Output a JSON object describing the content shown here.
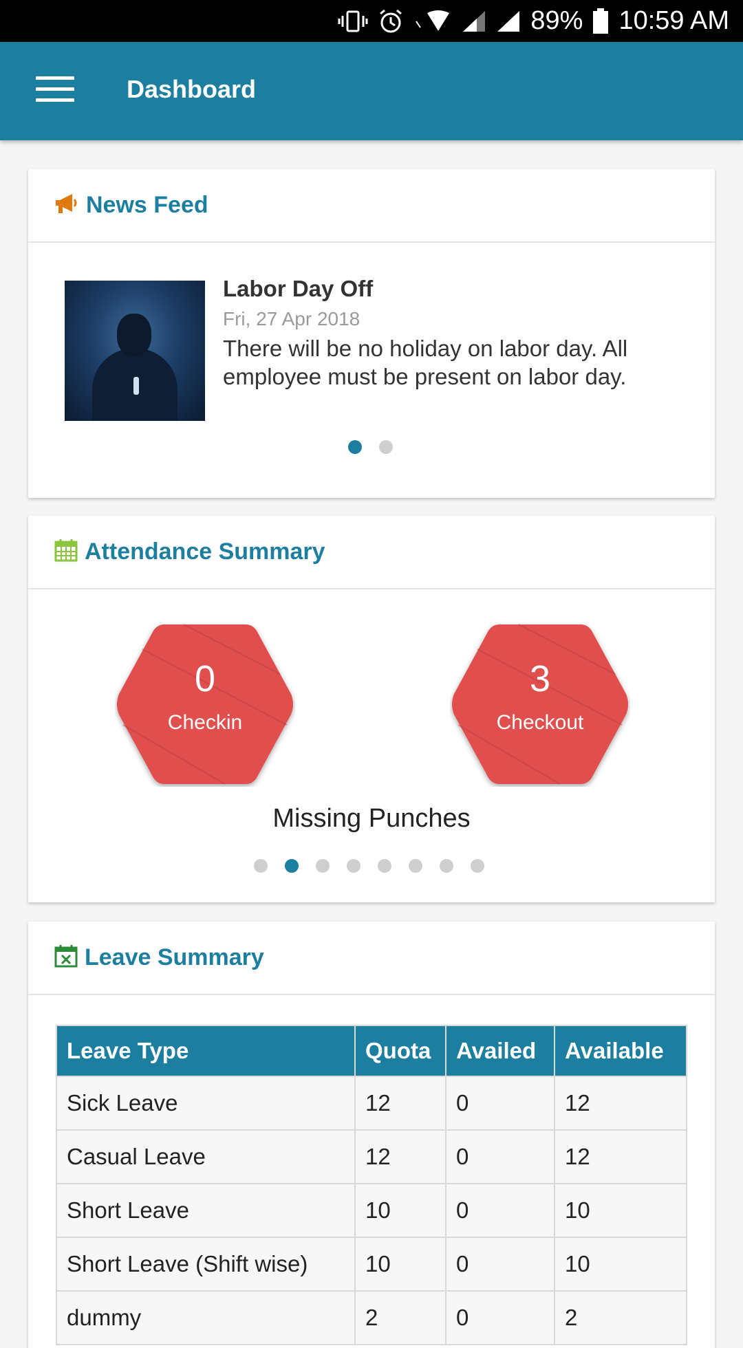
{
  "status_bar": {
    "battery": "89%",
    "time": "10:59 AM",
    "icons": [
      "vibrate-icon",
      "alarm-icon",
      "wifi-icon",
      "signal-icon",
      "signal-icon",
      "battery-icon"
    ]
  },
  "app_bar": {
    "title": "Dashboard",
    "menu_icon": "hamburger-menu-icon"
  },
  "news_feed": {
    "title": "News Feed",
    "icon": "megaphone-icon",
    "item": {
      "title": "Labor Day Off",
      "date": "Fri, 27 Apr 2018",
      "body": "There will be no holiday on labor day. All employee must be present on labor day."
    },
    "page_count": 2,
    "active_page": 0
  },
  "attendance": {
    "title": "Attendance Summary",
    "icon": "calendar-icon",
    "checkin": {
      "value": "0",
      "label": "Checkin"
    },
    "checkout": {
      "value": "3",
      "label": "Checkout"
    },
    "subtitle": "Missing Punches",
    "page_count": 8,
    "active_page": 1,
    "hex_color": "#e0504d"
  },
  "leave_summary": {
    "title": "Leave Summary",
    "icon": "calendar-x-icon",
    "columns": [
      "Leave Type",
      "Quota",
      "Availed",
      "Available"
    ],
    "rows": [
      [
        "Sick Leave",
        "12",
        "0",
        "12"
      ],
      [
        "Casual Leave",
        "12",
        "0",
        "12"
      ],
      [
        "Short Leave",
        "10",
        "0",
        "10"
      ],
      [
        "Short Leave (Shift wise)",
        "10",
        "0",
        "10"
      ],
      [
        "dummy",
        "2",
        "0",
        "2"
      ]
    ]
  },
  "colors": {
    "primary": "#1d7fa0",
    "accent_orange": "#e07a10",
    "calendar_green": "#8cc63f",
    "leave_icon_green": "#2e8b3a"
  }
}
